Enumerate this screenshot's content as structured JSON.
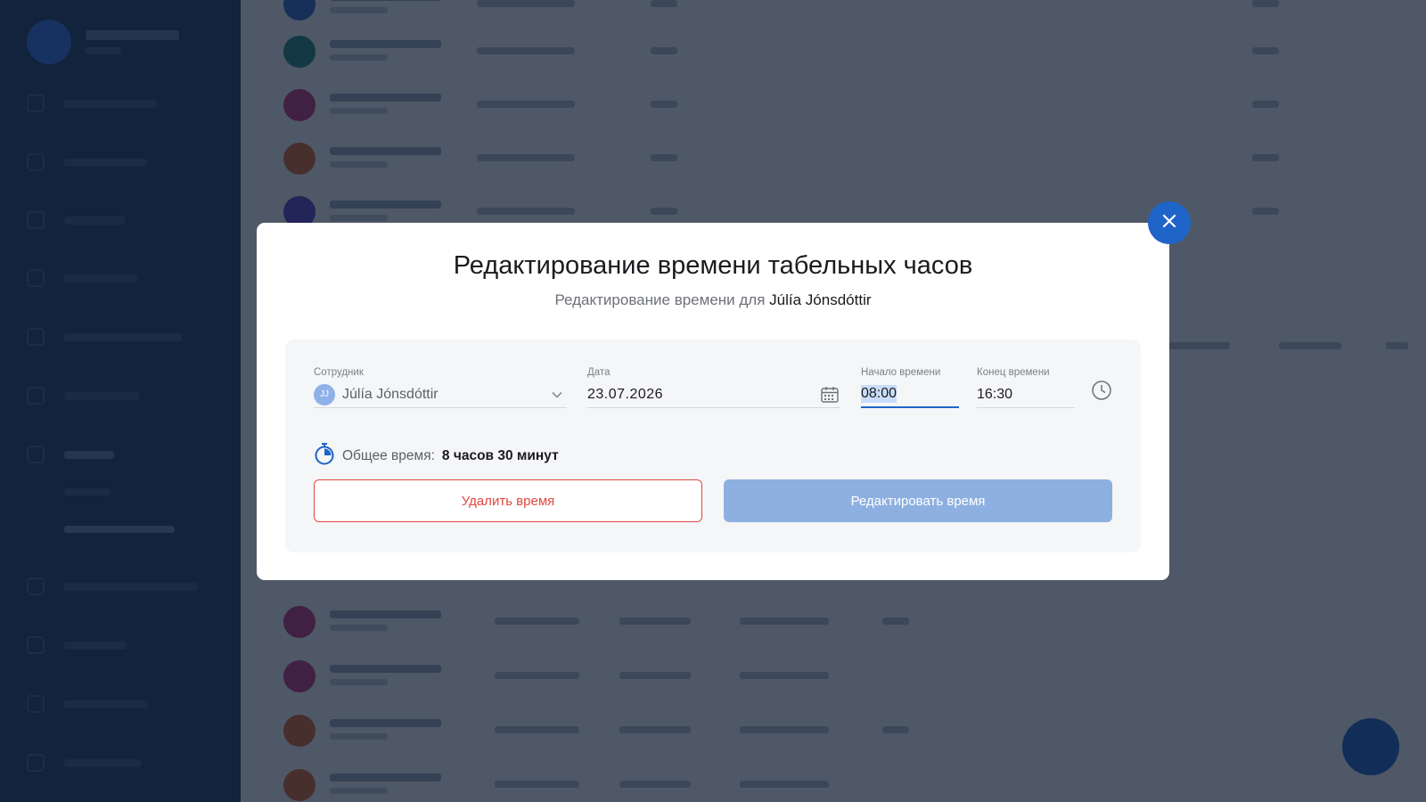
{
  "modal": {
    "title": "Редактирование времени табельных часов",
    "subtitle_prefix": "Редактирование времени для",
    "subtitle_name": "Júlía Jónsdóttir",
    "close_icon": "close-icon",
    "employee": {
      "label": "Сотрудник",
      "initials": "JJ",
      "value": "Júlía Jónsdóttir",
      "icon": "chevron-down-icon"
    },
    "date": {
      "label": "Дата",
      "value": "23.07.2026",
      "icon": "calendar-icon"
    },
    "start_time": {
      "label": "Начало времени",
      "value": "08:00"
    },
    "end_time": {
      "label": "Конец времени",
      "value": "16:30",
      "icon": "clock-icon"
    },
    "total": {
      "icon": "stopwatch-icon",
      "label": "Общее время:",
      "value": "8 часов 30 минут"
    },
    "delete_button": "Удалить время",
    "edit_button": "Редактировать время"
  },
  "colors": {
    "accent": "#1f64c8",
    "danger": "#e2473d",
    "edit_button_disabled": "#8eb0e1",
    "overlay": "#0e1a2e"
  }
}
